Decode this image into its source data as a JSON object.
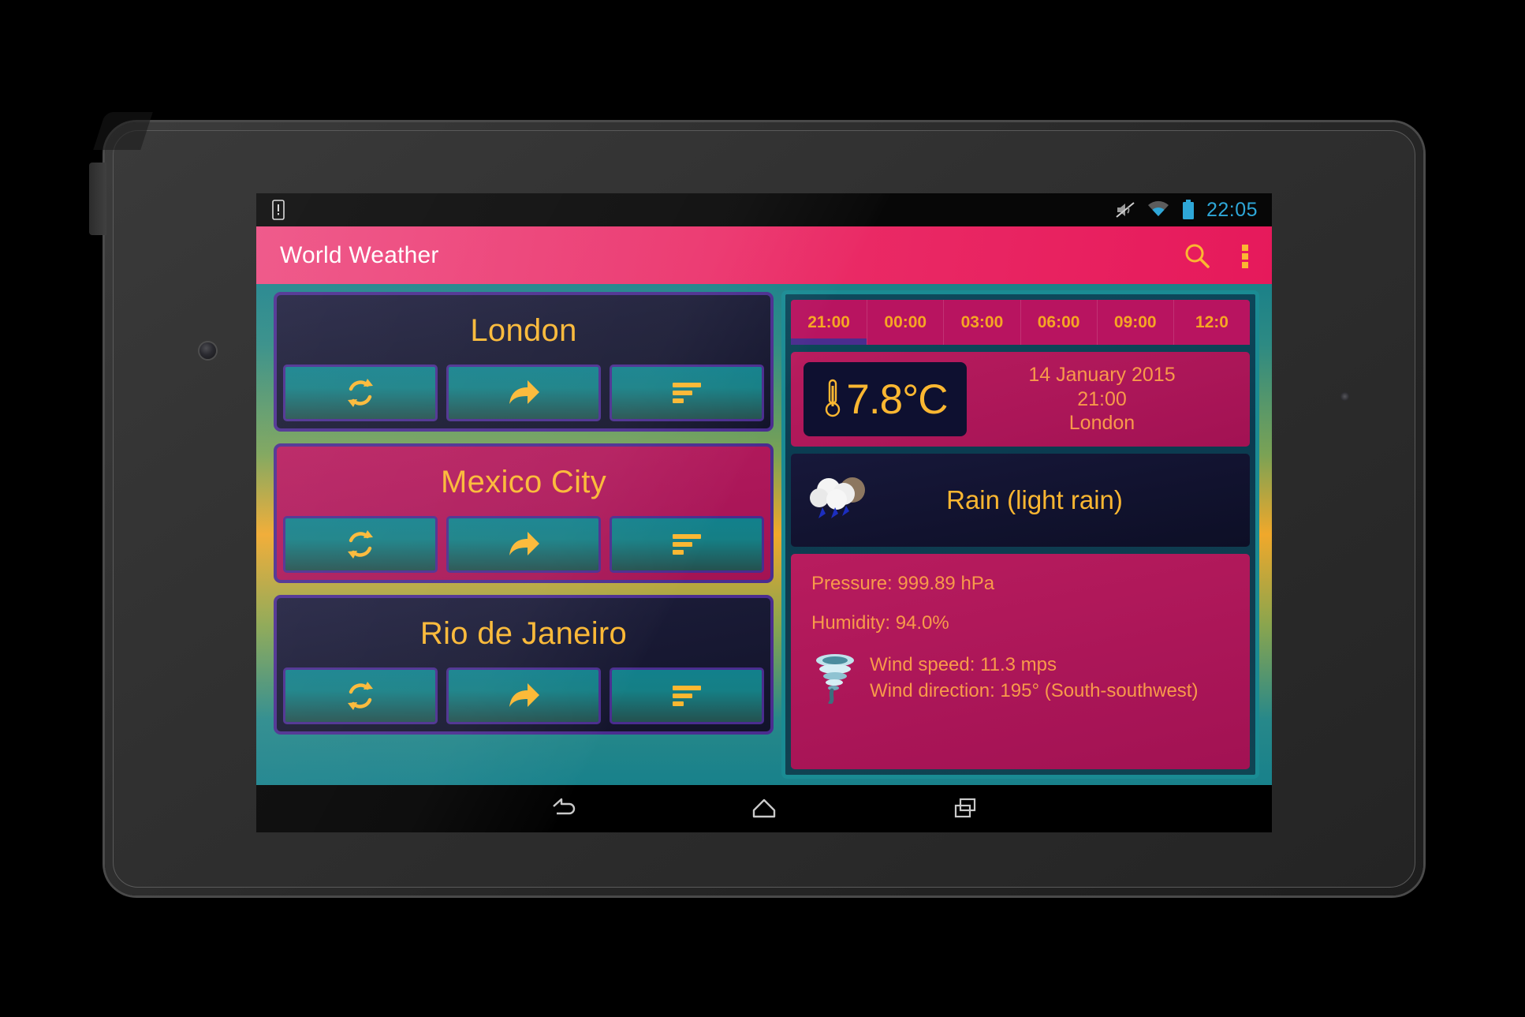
{
  "status_bar": {
    "notification_icon": "sim-card-alert-icon",
    "sound_icon": "volume-muted-icon",
    "wifi_icon": "wifi-icon",
    "battery_icon": "battery-full-icon",
    "clock": "22:05"
  },
  "app_bar": {
    "title": "World Weather",
    "search_icon": "search-icon",
    "overflow_icon": "overflow-menu-icon"
  },
  "cities": [
    {
      "name": "London",
      "selected": false,
      "actions": [
        "refresh-icon",
        "share-icon",
        "details-icon"
      ]
    },
    {
      "name": "Mexico City",
      "selected": true,
      "actions": [
        "refresh-icon",
        "share-icon",
        "details-icon"
      ]
    },
    {
      "name": "Rio de Janeiro",
      "selected": false,
      "actions": [
        "refresh-icon",
        "share-icon",
        "details-icon"
      ]
    }
  ],
  "forecast": {
    "hour_tabs": [
      {
        "label": "21:00",
        "active": true
      },
      {
        "label": "00:00",
        "active": false
      },
      {
        "label": "03:00",
        "active": false
      },
      {
        "label": "06:00",
        "active": false
      },
      {
        "label": "09:00",
        "active": false
      },
      {
        "label": "12:0",
        "active": false
      }
    ],
    "temperature": "7.8°C",
    "thermometer_icon": "thermometer-icon",
    "date": "14 January 2015",
    "time": "21:00",
    "city": "London",
    "condition_icon": "rain-cloud-icon",
    "condition": "Rain (light rain)",
    "pressure": "Pressure: 999.89 hPa",
    "humidity": "Humidity: 94.0%",
    "wind_icon": "tornado-icon",
    "wind_speed": "Wind speed: 11.3 mps",
    "wind_direction": "Wind direction: 195° (South-southwest)"
  },
  "nav_bar": {
    "back_icon": "back-icon",
    "home_icon": "home-icon",
    "recents_icon": "recent-apps-icon"
  },
  "colors": {
    "app_bar_pink": "#ea2b66",
    "accent_orange": "#fbb731",
    "card_purple_border": "#4a2d8f",
    "card_magenta": "#b81c5e",
    "card_dark_navy": "#151634",
    "button_teal": "#12808c",
    "panel_teal_border": "#1a8b93",
    "status_clock_blue": "#2ea7d8"
  }
}
